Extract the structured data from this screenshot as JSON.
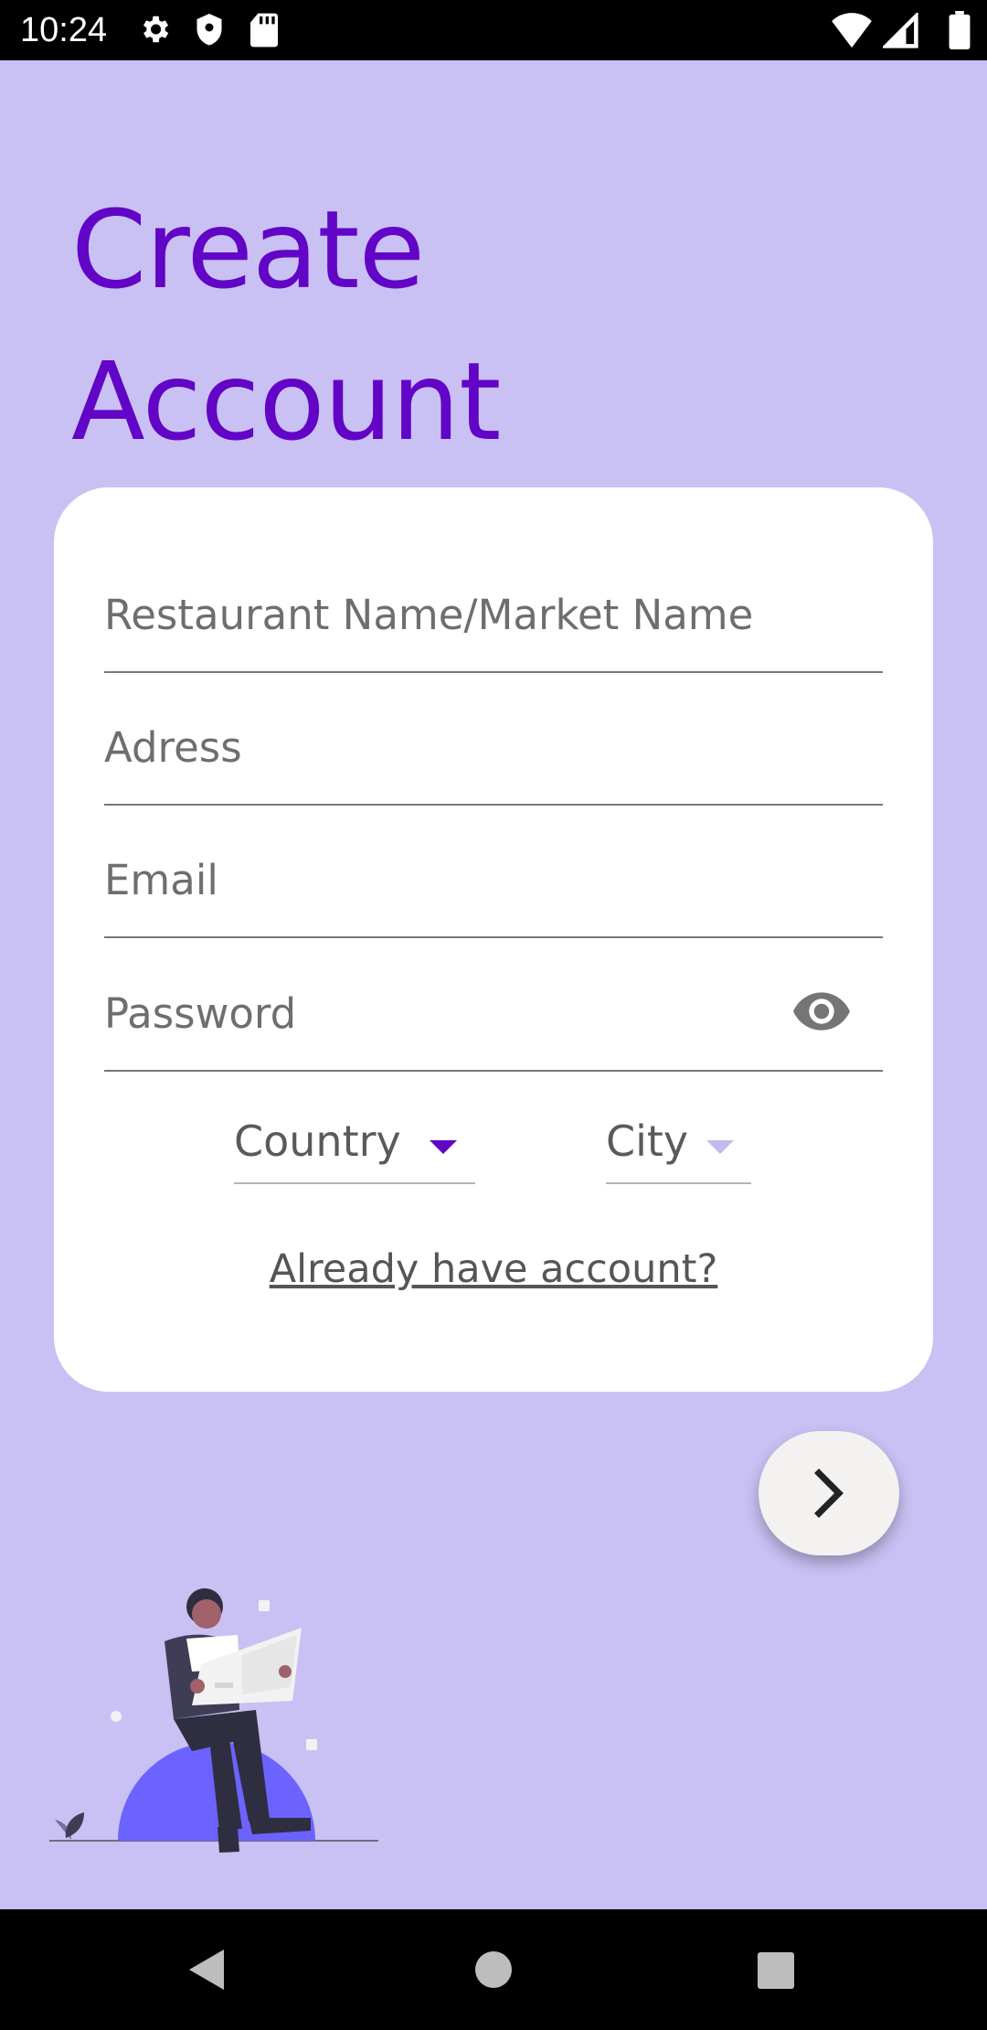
{
  "status_bar": {
    "time": "10:24",
    "icons_left": [
      "gear-icon",
      "shield-icon",
      "sd-card-icon"
    ],
    "icons_right": [
      "wifi-icon",
      "signal-icon",
      "battery-icon"
    ]
  },
  "title": {
    "line1": "Create",
    "line2": "Account",
    "color": "#6205c7"
  },
  "form": {
    "restaurant_placeholder": "Restaurant Name/Market Name",
    "address_placeholder": "Adress",
    "email_placeholder": "Email",
    "password_placeholder": "Password",
    "country_label": "Country",
    "city_label": "City",
    "login_link": "Already have account?"
  },
  "colors": {
    "background": "#c9c1f3",
    "accent": "#6205c7",
    "card": "#ffffff"
  },
  "fab": {
    "icon": "chevron-right-icon"
  },
  "nav": {
    "back": "back-icon",
    "home": "home-icon",
    "recents": "recents-icon"
  }
}
